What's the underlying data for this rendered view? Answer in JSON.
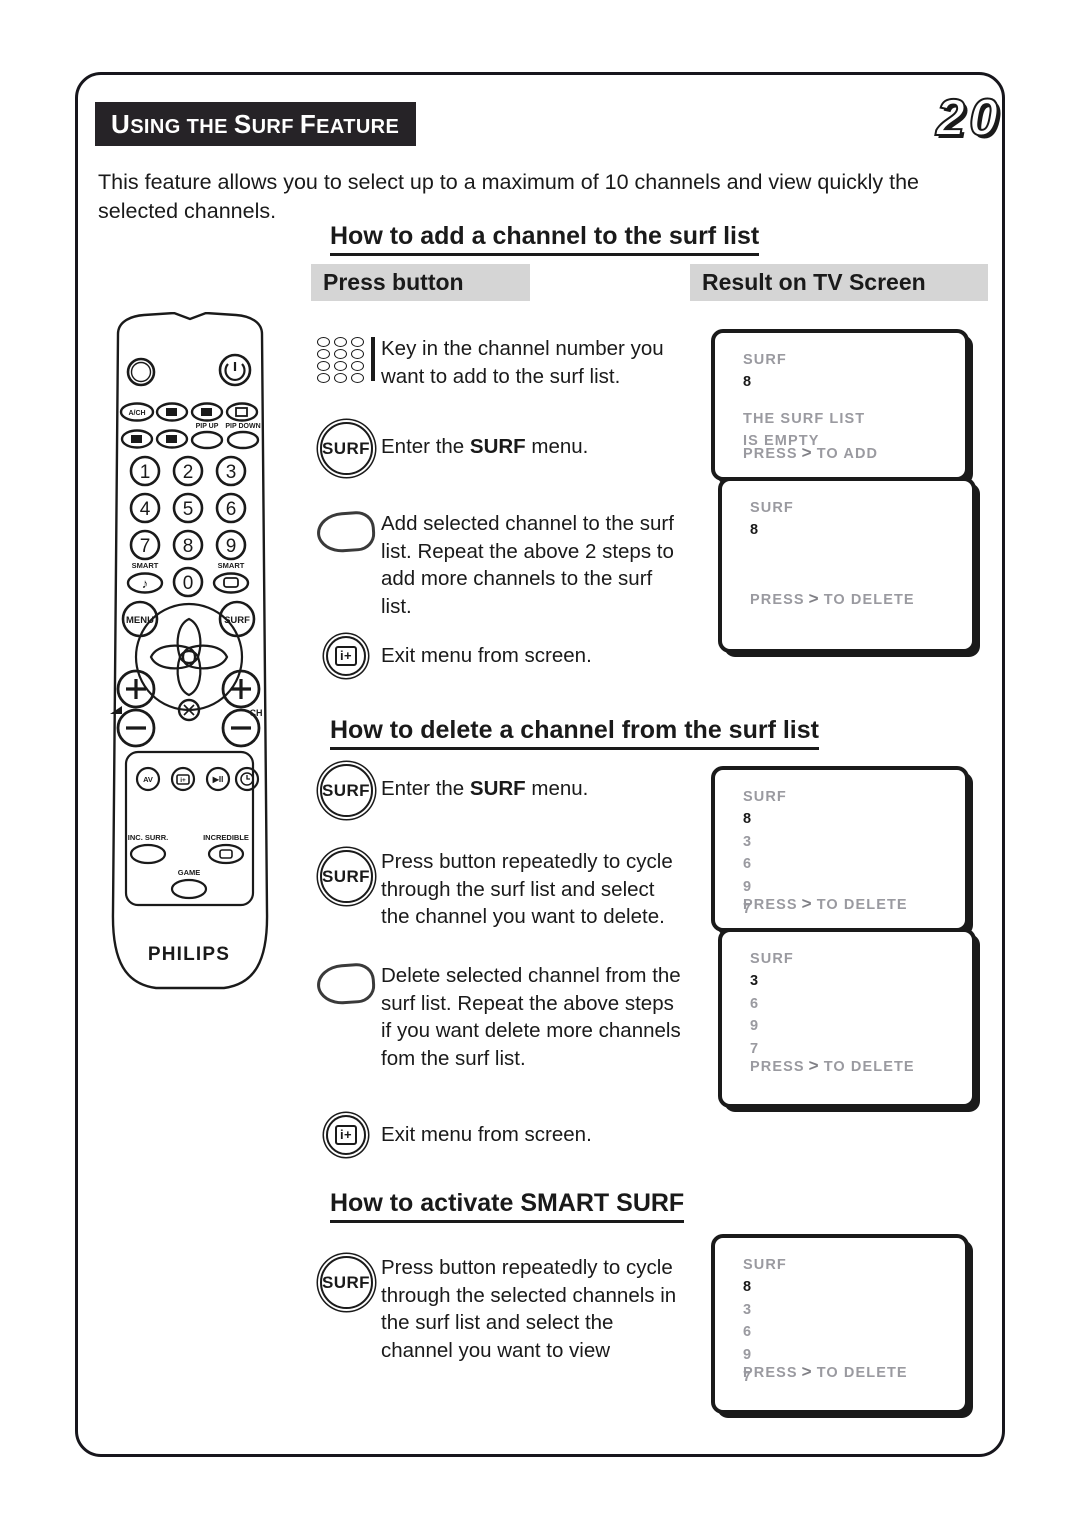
{
  "page": {
    "number": "20",
    "title_lead": "U",
    "title_rest1": "SING THE ",
    "title": "USING THE SURF FEATURE",
    "intro": "This feature allows you to select up to a maximum of 10 channels and view quickly the selected channels."
  },
  "columns": {
    "press_button": "Press button",
    "result_on_tv": "Result on TV Screen"
  },
  "sections": {
    "add": {
      "heading": "How to add a channel to the surf list",
      "steps": [
        {
          "icon": "number-keypad-icon",
          "text": "Key in the channel number you want to add to the surf list."
        },
        {
          "icon": "surf-button-icon",
          "label": "SURF",
          "text_pre": "Enter the ",
          "text_bold": "SURF",
          "text_post": " menu."
        },
        {
          "icon": "right-arrow-teardrop-icon",
          "text": "Add selected channel to the surf list. Repeat the above  2 steps to add more channels to the surf list."
        },
        {
          "icon": "info-plus-button-icon",
          "label": "i+",
          "text": "Exit menu from screen."
        }
      ],
      "screens": [
        {
          "title": "SURF",
          "current": "8",
          "list": [],
          "message": [
            "THE SURF LIST",
            "IS EMPTY"
          ],
          "footer_pre": "PRESS",
          "footer_gt": ">",
          "footer_post": "TO ADD"
        },
        {
          "title": "SURF",
          "current": "8",
          "list": [],
          "message": [],
          "footer_pre": "PRESS",
          "footer_gt": ">",
          "footer_post": "TO DELETE"
        }
      ]
    },
    "delete": {
      "heading": "How to delete a channel from the surf list",
      "steps": [
        {
          "icon": "surf-button-icon",
          "label": "SURF",
          "text_pre": "Enter the ",
          "text_bold": "SURF",
          "text_post": " menu."
        },
        {
          "icon": "surf-button-icon",
          "label": "SURF",
          "text": "Press button repeatedly to cycle through the surf list and select the channel you want to delete."
        },
        {
          "icon": "right-arrow-teardrop-icon",
          "text": "Delete selected channel from the surf list. Repeat the above steps if you want delete more channels fom the surf list."
        },
        {
          "icon": "info-plus-button-icon",
          "label": "i+",
          "text": "Exit menu from screen."
        }
      ],
      "screens": [
        {
          "title": "SURF",
          "current": "8",
          "list": [
            "3",
            "6",
            "9",
            "7"
          ],
          "message": [],
          "footer_pre": "PRESS",
          "footer_gt": ">",
          "footer_post": "TO DELETE"
        },
        {
          "title": "SURF",
          "current": "3",
          "list": [
            "6",
            "9",
            "7"
          ],
          "message": [],
          "footer_pre": "PRESS",
          "footer_gt": ">",
          "footer_post": "TO DELETE"
        }
      ]
    },
    "smart": {
      "heading": "How to activate SMART SURF",
      "steps": [
        {
          "icon": "surf-button-icon",
          "label": "SURF",
          "text": "Press button repeatedly to cycle through the selected channels in the surf list and select the channel you want to view"
        }
      ],
      "screens": [
        {
          "title": "SURF",
          "current": "8",
          "list": [
            "3",
            "6",
            "9",
            "7"
          ],
          "message": [],
          "footer_pre": "PRESS",
          "footer_gt": ">",
          "footer_post": "TO DELETE"
        }
      ]
    }
  },
  "remote": {
    "brand": "PHILIPS",
    "labels": {
      "acw": "A/CH",
      "pip_up": "PIP UP",
      "pip_down": "PIP DOWN",
      "smart_sound": "SMART",
      "smart_picture": "SMART",
      "menu": "MENU",
      "surf": "SURF",
      "ch": "CH",
      "av": "AV",
      "inc_surr": "INC. SURR.",
      "incredible": "INCREDIBLE",
      "game": "GAME"
    },
    "keys": [
      "1",
      "2",
      "3",
      "4",
      "5",
      "6",
      "7",
      "8",
      "9",
      "0"
    ]
  },
  "colors": {
    "title_bar": "#262327",
    "col_head_bg": "#d5d5d5",
    "tv_text": "#9a9aa0",
    "ink": "#1a1a1a"
  }
}
